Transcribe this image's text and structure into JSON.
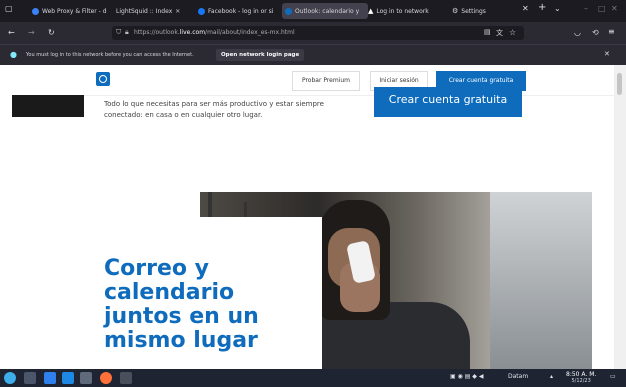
{
  "browser": {
    "tabs": [
      {
        "label": "Web Proxy & Filter - d",
        "color": "#3b82f6"
      },
      {
        "label": "LightSquid :: Index",
        "color": "#1c1b22"
      },
      {
        "label": "Facebook - log in or si",
        "color": "#1877f2"
      },
      {
        "label": "Outlook: calendario y",
        "color": "#0f6cbd"
      },
      {
        "label": "Log in to network",
        "color": "#ffffff"
      },
      {
        "label": "Settings",
        "color": "#cccccc"
      }
    ],
    "url_prefix": "https://outlook.",
    "url_domain": "live.com",
    "url_path": "/mail/about/index_es-mx.html"
  },
  "notification": {
    "text": "You must log in to this network before you can access the Internet.",
    "button": "Open network login page"
  },
  "header": {
    "premium": "Probar Premium",
    "signin": "Iniciar sesión",
    "create": "Crear cuenta gratuita"
  },
  "main": {
    "intro_line1": "Todo lo que necesitas para ser más productivo y estar siempre",
    "intro_line2": "conectado: en casa o en cualquier otro lugar.",
    "cta": "Crear cuenta gratuita",
    "headline": [
      "Correo y",
      "calendario",
      "juntos en un",
      "mismo lugar"
    ]
  },
  "taskbar": {
    "tray_text": "Datam",
    "time": "8:50 A. M.",
    "date": "5/12/23"
  }
}
